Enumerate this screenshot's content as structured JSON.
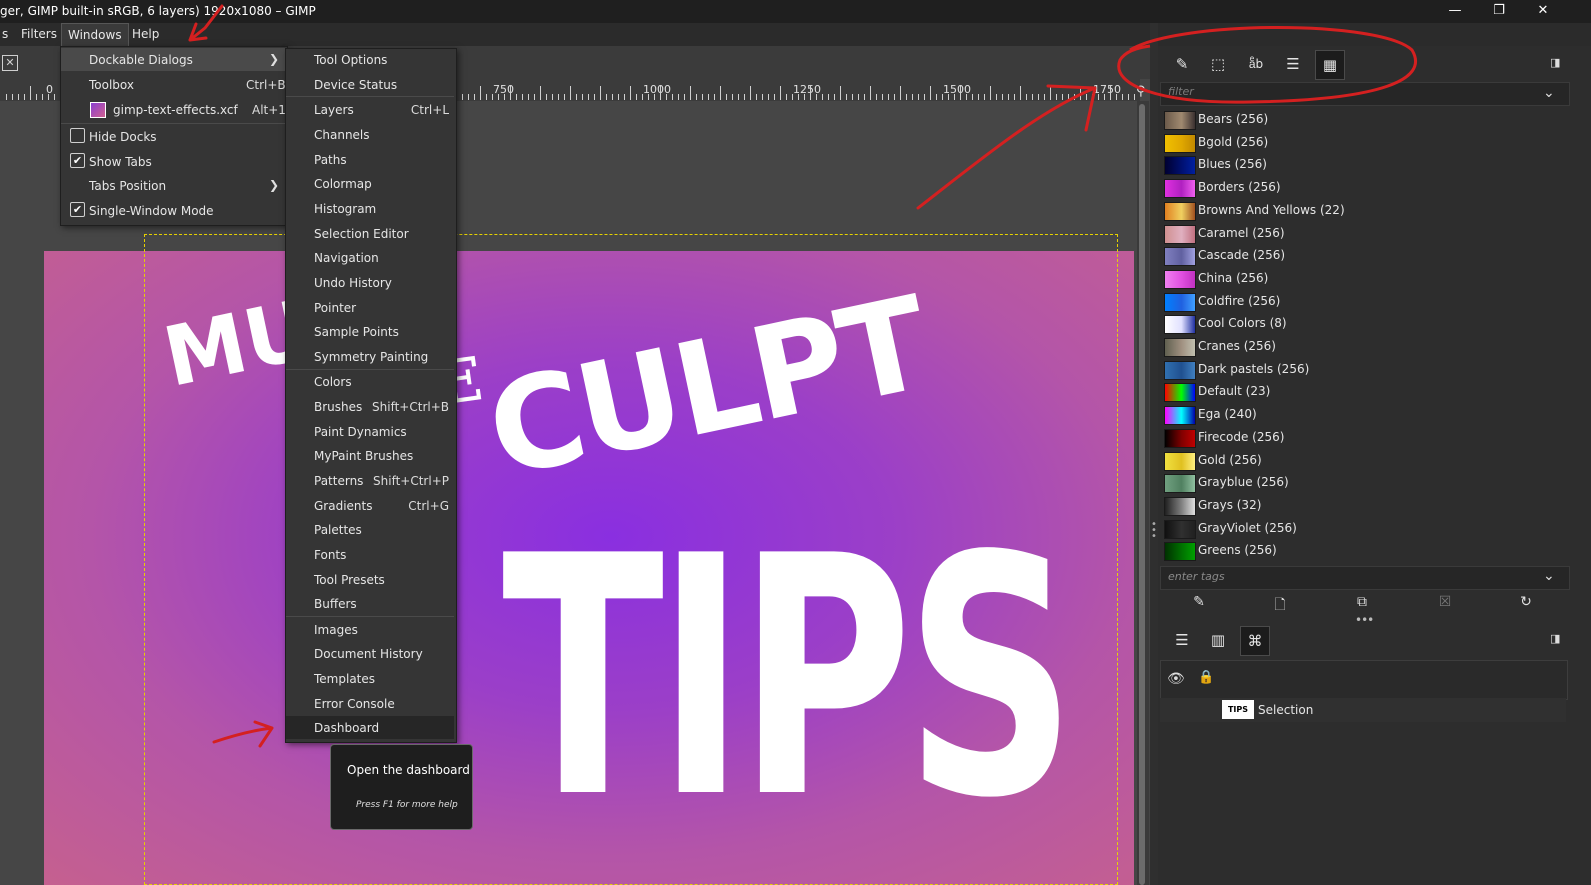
{
  "window": {
    "title": "ger, GIMP built-in sRGB, 6 layers) 1920x1080 – GIMP",
    "controls": {
      "minimize": "—",
      "maximize": "❐",
      "close": "✕"
    }
  },
  "menubar": {
    "items": [
      {
        "key": "cut",
        "label": "s"
      },
      {
        "key": "filters",
        "label": "Filters"
      },
      {
        "key": "windows",
        "label": "Windows"
      },
      {
        "key": "help",
        "label": "Help"
      }
    ]
  },
  "ruler": {
    "labels": [
      "0",
      "750",
      "1000",
      "1250",
      "1500",
      "1750"
    ]
  },
  "windows_menu": {
    "items": [
      {
        "label": "Dockable Dialogs",
        "submenu": true
      },
      {
        "label": "Toolbox",
        "accel": "Ctrl+B"
      },
      {
        "label": "gimp-text-effects.xcf",
        "accel": "Alt+1"
      },
      {
        "label": "Hide Docks",
        "checked": false
      },
      {
        "label": "Show Tabs",
        "checked": true
      },
      {
        "label": "Tabs Position",
        "submenu": true
      },
      {
        "label": "Single-Window Mode",
        "checked": true
      }
    ]
  },
  "dockable_menu": {
    "items": [
      {
        "label": "Tool Options",
        "accel": ""
      },
      {
        "label": "Device Status",
        "accel": ""
      },
      {
        "label": "Layers",
        "accel": "Ctrl+L"
      },
      {
        "label": "Channels",
        "accel": ""
      },
      {
        "label": "Paths",
        "accel": ""
      },
      {
        "label": "Colormap",
        "accel": ""
      },
      {
        "label": "Histogram",
        "accel": ""
      },
      {
        "label": "Selection Editor",
        "accel": ""
      },
      {
        "label": "Navigation",
        "accel": ""
      },
      {
        "label": "Undo History",
        "accel": ""
      },
      {
        "label": "Pointer",
        "accel": ""
      },
      {
        "label": "Sample Points",
        "accel": ""
      },
      {
        "label": "Symmetry Painting",
        "accel": ""
      },
      {
        "label": "Colors",
        "accel": ""
      },
      {
        "label": "Brushes",
        "accel": "Shift+Ctrl+B"
      },
      {
        "label": "Paint Dynamics",
        "accel": ""
      },
      {
        "label": "MyPaint Brushes",
        "accel": ""
      },
      {
        "label": "Patterns",
        "accel": "Shift+Ctrl+P"
      },
      {
        "label": "Gradients",
        "accel": "Ctrl+G"
      },
      {
        "label": "Palettes",
        "accel": ""
      },
      {
        "label": "Fonts",
        "accel": ""
      },
      {
        "label": "Tool Presets",
        "accel": ""
      },
      {
        "label": "Buffers",
        "accel": ""
      },
      {
        "label": "Images",
        "accel": ""
      },
      {
        "label": "Document History",
        "accel": ""
      },
      {
        "label": "Templates",
        "accel": ""
      },
      {
        "label": "Error Console",
        "accel": ""
      },
      {
        "label": "Dashboard",
        "accel": ""
      }
    ]
  },
  "tooltip": {
    "title": "Open the dashboard",
    "help": "Press F1 for more help"
  },
  "canvas": {
    "text_top": "MU",
    "text_mid_e": "E",
    "text_sculpt": "CULPT",
    "text_tips": "TIPS"
  },
  "dock": {
    "tabs": [
      "paintbrush-icon",
      "selection-icon",
      "text-icon",
      "layers-icon",
      "palettes-icon"
    ],
    "filter_placeholder": "filter",
    "tags_placeholder": "enter tags",
    "palettes": [
      {
        "name": "Bears (256)",
        "colors": [
          "#6b5a4a",
          "#a08a70",
          "#3a3030"
        ]
      },
      {
        "name": "Bgold (256)",
        "colors": [
          "#f0c000",
          "#e0a800",
          "#c08800"
        ]
      },
      {
        "name": "Blues (256)",
        "colors": [
          "#000030",
          "#001070",
          "#0020a0"
        ]
      },
      {
        "name": "Borders (256)",
        "colors": [
          "#e030e0",
          "#b020c0",
          "#f060f0"
        ]
      },
      {
        "name": "Browns And Yellows (22)",
        "colors": [
          "#e08020",
          "#f0d060",
          "#a05020"
        ]
      },
      {
        "name": "Caramel (256)",
        "colors": [
          "#d09090",
          "#e0b0c0",
          "#c07080"
        ]
      },
      {
        "name": "Cascade (256)",
        "colors": [
          "#8080c0",
          "#6060a0",
          "#a0a0e0"
        ]
      },
      {
        "name": "China (256)",
        "colors": [
          "#f080f0",
          "#e050e0",
          "#c030c0"
        ]
      },
      {
        "name": "Coldfire (256)",
        "colors": [
          "#0080ff",
          "#2060e0",
          "#40a0ff"
        ]
      },
      {
        "name": "Cool Colors (8)",
        "colors": [
          "#ffffff",
          "#e0e0ff",
          "#2030a0"
        ]
      },
      {
        "name": "Cranes (256)",
        "colors": [
          "#606050",
          "#a09080",
          "#c0c0b0"
        ]
      },
      {
        "name": "Dark pastels (256)",
        "colors": [
          "#3070b0",
          "#205090",
          "#4080c0"
        ]
      },
      {
        "name": "Default (23)",
        "colors": [
          "#ff0000",
          "#00ff00",
          "#0000ff"
        ]
      },
      {
        "name": "Ega (240)",
        "colors": [
          "#ff00ff",
          "#00ffff",
          "#0000aa"
        ]
      },
      {
        "name": "Firecode (256)",
        "colors": [
          "#000000",
          "#800000",
          "#c00000"
        ]
      },
      {
        "name": "Gold (256)",
        "colors": [
          "#f0e040",
          "#e0c020",
          "#fff080"
        ]
      },
      {
        "name": "Grayblue (256)",
        "colors": [
          "#70a080",
          "#508060",
          "#90c0a0"
        ]
      },
      {
        "name": "Grays (32)",
        "colors": [
          "#202020",
          "#808080",
          "#e0e0e0"
        ]
      },
      {
        "name": "GrayViolet (256)",
        "colors": [
          "#101010",
          "#303030",
          "#202020"
        ]
      },
      {
        "name": "Greens (256)",
        "colors": [
          "#003000",
          "#007000",
          "#00a000"
        ]
      }
    ],
    "toolbar": [
      "edit-palette-icon",
      "new-palette-icon",
      "duplicate-palette-icon",
      "delete-palette-icon",
      "refresh-icon"
    ],
    "lower_tabs": [
      "layers-icon",
      "channels-icon",
      "paths-icon"
    ],
    "layer": {
      "name": "Selection",
      "thumb_text": "TIPS"
    }
  },
  "colors": {
    "accent_annotation": "#d42020",
    "selection_border": "#e6d200"
  }
}
